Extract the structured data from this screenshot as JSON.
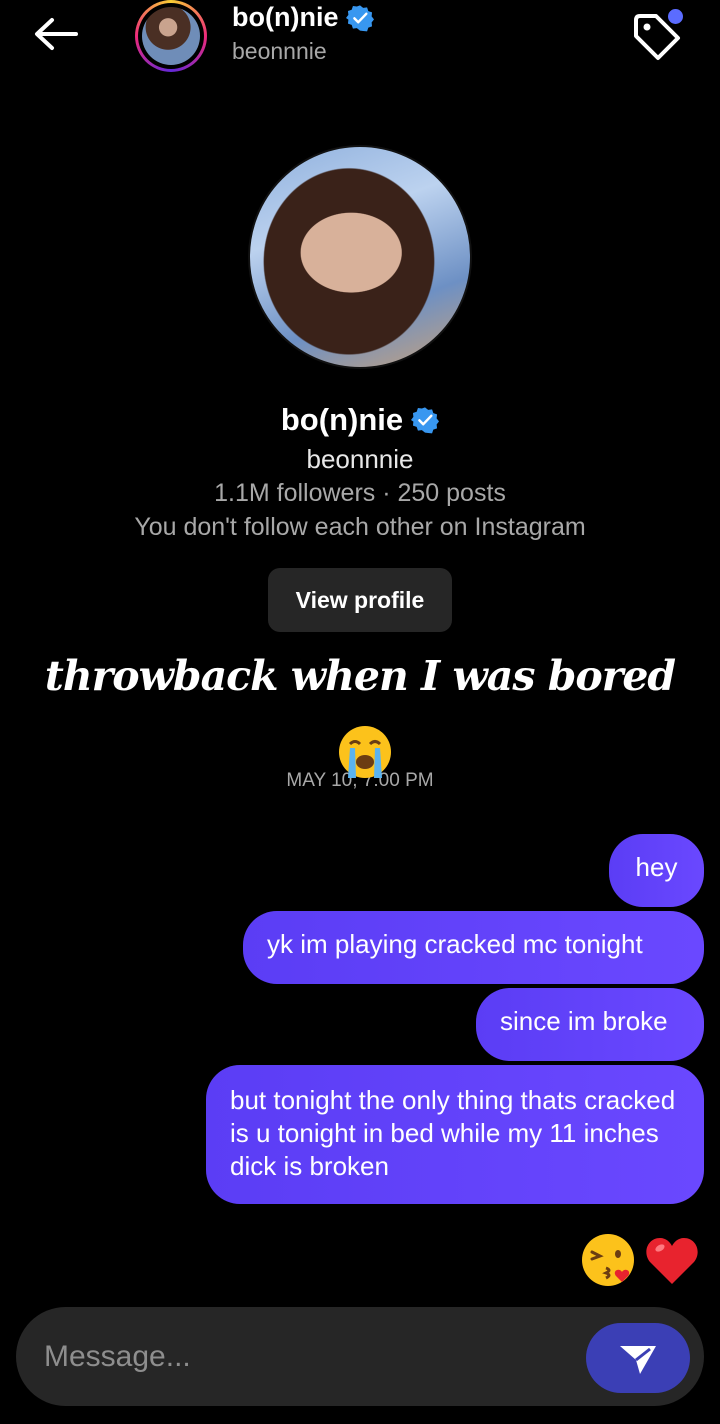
{
  "header": {
    "name": "bo(n)nie",
    "username": "beonnnie",
    "back_icon": "arrow-left-icon",
    "tag_icon": "tag-icon"
  },
  "profile": {
    "name": "bo(n)nie",
    "username": "beonnnie",
    "stats": "1.1M followers · 250 posts",
    "follow_status": "You don't follow each other on Instagram",
    "view_profile_label": "View profile"
  },
  "caption": "throwback when I was bored",
  "timestamp": "MAY 10, 7:00 PM",
  "messages": [
    {
      "text": "hey"
    },
    {
      "text": "yk im playing cracked mc tonight"
    },
    {
      "text": "since im broke"
    },
    {
      "text": "but tonight the only thing thats cracked is u tonight in bed while my 11 inches dick is broken"
    }
  ],
  "reactions": [
    "kissing-face-heart-icon",
    "red-heart-icon"
  ],
  "composer": {
    "placeholder": "Message...",
    "send_icon": "send-icon"
  },
  "colors": {
    "bubble": "#6a48ff",
    "verified": "#3897f0",
    "accent_dot": "#5b6cff"
  }
}
